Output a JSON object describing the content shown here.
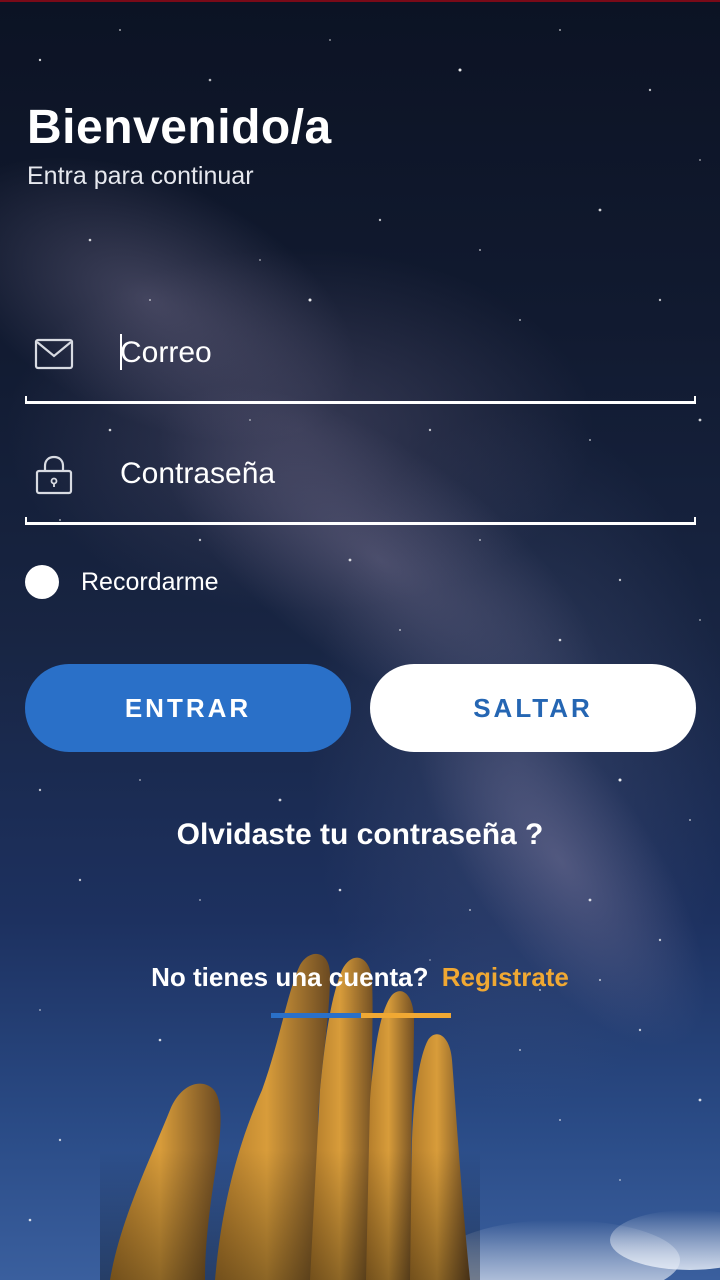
{
  "header": {
    "title": "Bienvenido/a",
    "subtitle": "Entra para continuar"
  },
  "form": {
    "email": {
      "placeholder": "Correo",
      "value": "",
      "icon": "mail-icon"
    },
    "password": {
      "placeholder": "Contraseña",
      "value": "",
      "icon": "lock-icon"
    },
    "remember_label": "Recordarme",
    "remember_checked": false
  },
  "actions": {
    "enter_label": "ENTRAR",
    "skip_label": "SALTAR",
    "forgot_label": "Olvidaste tu contraseña ?",
    "no_account_label": "No tienes una cuenta?",
    "register_label": "Registrate"
  },
  "colors": {
    "primary": "#2a70c8",
    "accent": "#f0a833",
    "text": "#ffffff"
  }
}
